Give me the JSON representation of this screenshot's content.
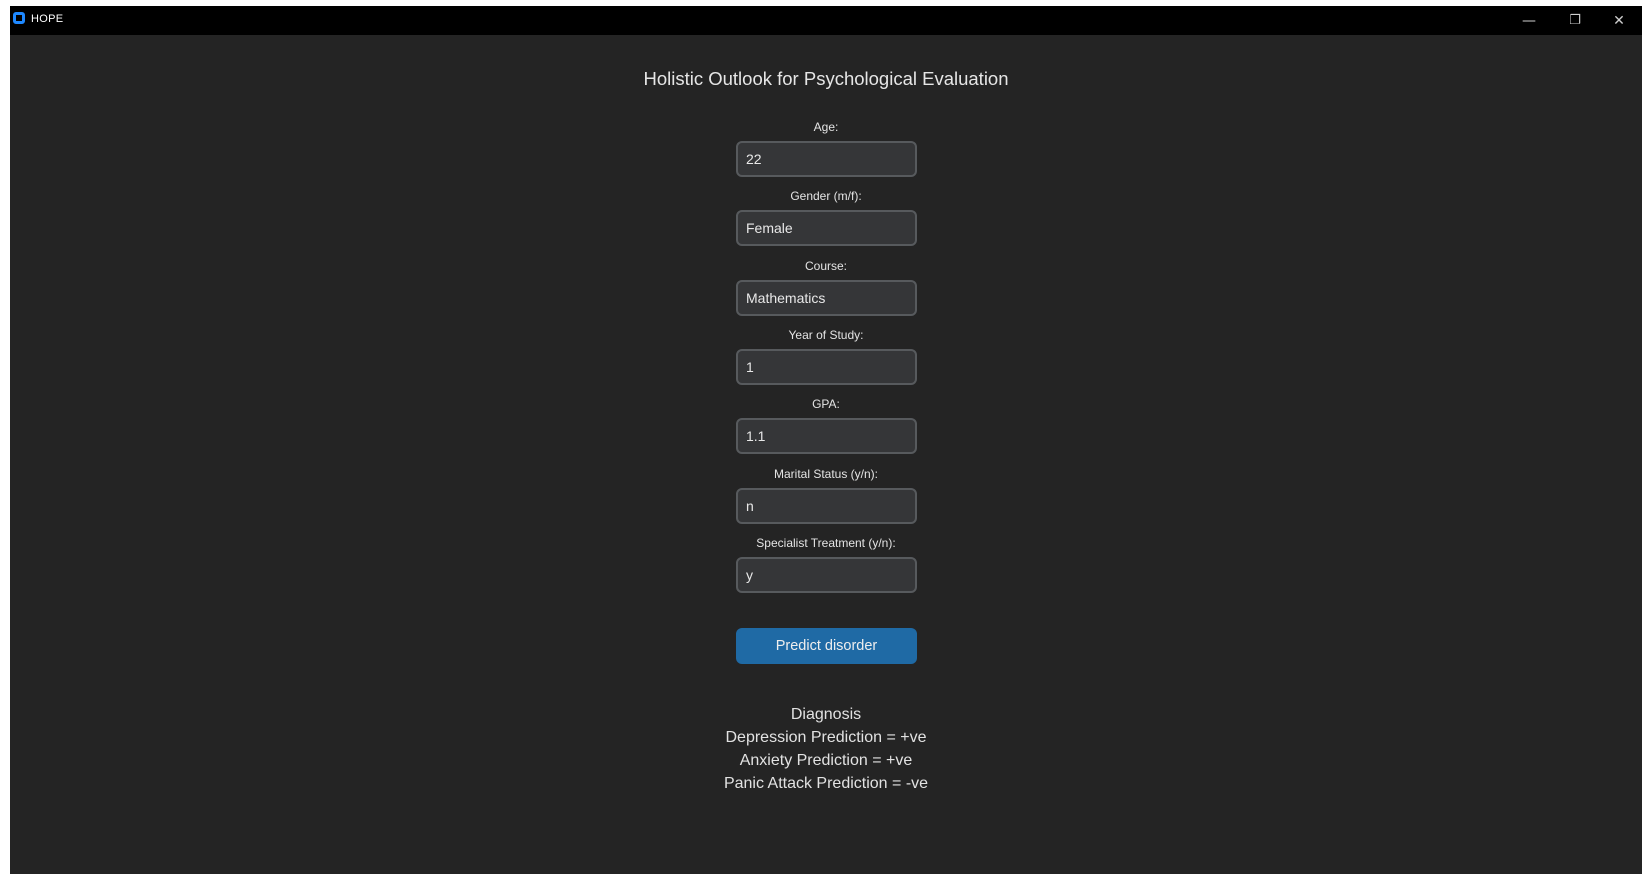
{
  "window": {
    "title": "HOPE",
    "controls": {
      "minimize": "—",
      "maximize": "❐",
      "close": "✕"
    }
  },
  "colors": {
    "background": "#242424",
    "titlebar": "#000000",
    "input_bg": "#353638",
    "input_border": "#575a5d",
    "button": "#1f6aa5",
    "icon_accent": "#1e88ff"
  },
  "form": {
    "heading": "Holistic Outlook for Psychological Evaluation",
    "fields": [
      {
        "label": "Age:",
        "value": "22"
      },
      {
        "label": "Gender (m/f):",
        "value": "Female"
      },
      {
        "label": "Course:",
        "value": "Mathematics"
      },
      {
        "label": "Year of Study:",
        "value": "1"
      },
      {
        "label": "GPA:",
        "value": "1.1"
      },
      {
        "label": "Marital Status (y/n):",
        "value": "n"
      },
      {
        "label": "Specialist Treatment (y/n):",
        "value": "y"
      }
    ],
    "submit_label": "Predict disorder"
  },
  "diagnosis": {
    "title": "Diagnosis",
    "lines": [
      "Depression Prediction = +ve",
      "Anxiety Prediction = +ve",
      "Panic Attack Prediction = -ve"
    ]
  }
}
